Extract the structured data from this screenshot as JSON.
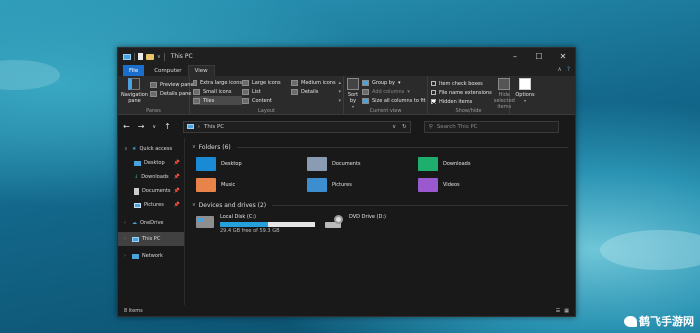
{
  "window": {
    "title": "This PC"
  },
  "tabs": [
    {
      "label": "File"
    },
    {
      "label": "Computer"
    },
    {
      "label": "View"
    }
  ],
  "ribbon": {
    "panes": {
      "label": "Panes",
      "navigation_pane": "Navigation pane",
      "preview_pane": "Preview pane",
      "details_pane": "Details pane"
    },
    "layout": {
      "label": "Layout",
      "items": [
        "Extra large icons",
        "Large icons",
        "Medium icons",
        "Small icons",
        "List",
        "Details",
        "Tiles",
        "Content"
      ]
    },
    "current_view": {
      "label": "Current view",
      "sort_by": "Sort by",
      "group_by": "Group by",
      "add_columns": "Add columns",
      "size_columns": "Size all columns to fit"
    },
    "show_hide": {
      "label": "Show/hide",
      "item_check_boxes": "Item check boxes",
      "file_name_extensions": "File name extensions",
      "hidden_items": "Hidden items",
      "hide_selected": "Hide selected items",
      "options": "Options"
    }
  },
  "address": {
    "path": "This PC",
    "search_placeholder": "Search This PC"
  },
  "sidebar": {
    "quick_access": "Quick access",
    "items": [
      {
        "label": "Desktop"
      },
      {
        "label": "Downloads"
      },
      {
        "label": "Documents"
      },
      {
        "label": "Pictures"
      }
    ],
    "onedrive": "OneDrive",
    "this_pc": "This PC",
    "network": "Network"
  },
  "folders": {
    "heading": "Folders (6)",
    "items": [
      {
        "label": "Desktop",
        "icon": "desktop-folder-icon"
      },
      {
        "label": "Documents",
        "icon": "documents-folder-icon"
      },
      {
        "label": "Downloads",
        "icon": "downloads-folder-icon"
      },
      {
        "label": "Music",
        "icon": "music-folder-icon"
      },
      {
        "label": "Pictures",
        "icon": "pictures-folder-icon"
      },
      {
        "label": "Videos",
        "icon": "videos-folder-icon"
      }
    ]
  },
  "drives": {
    "heading": "Devices and drives (2)",
    "local_disk": {
      "label": "Local Disk (C:)",
      "free": "29.4 GB free of 59.3 GB",
      "used_fraction": 0.5
    },
    "dvd": {
      "label": "DVD Drive (D:)"
    }
  },
  "status": {
    "count": "8 items"
  },
  "watermark": {
    "text": "鹤飞手游网"
  },
  "colors": {
    "accent": "#1a6fcc",
    "folder": "#e9c46a",
    "usage_bar": "#26a0da"
  }
}
